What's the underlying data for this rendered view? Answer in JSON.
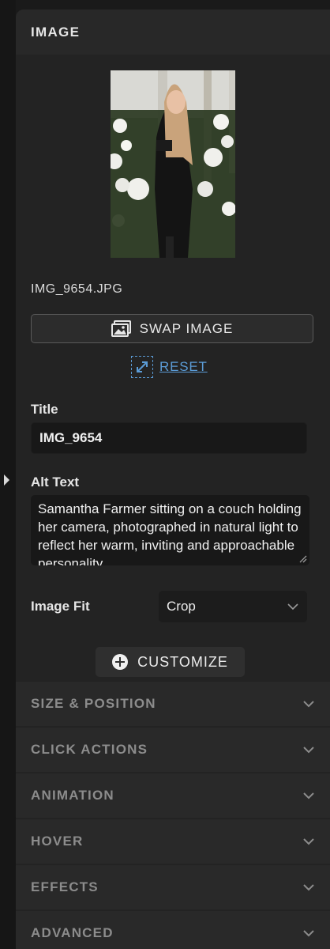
{
  "panel": {
    "title": "IMAGE"
  },
  "image": {
    "filename": "IMG_9654.JPG"
  },
  "actions": {
    "swap_label": "SWAP IMAGE",
    "reset_label": "RESET",
    "customize_label": "CUSTOMIZE"
  },
  "fields": {
    "title_label": "Title",
    "title_value": "IMG_9654",
    "alt_label": "Alt Text",
    "alt_value": "Samantha Farmer sitting on a couch holding her camera, photographed in natural light to reflect her warm, inviting and approachable personality",
    "fit_label": "Image Fit",
    "fit_value": "Crop"
  },
  "sections": [
    {
      "label": "SIZE & POSITION"
    },
    {
      "label": "CLICK ACTIONS"
    },
    {
      "label": "ANIMATION"
    },
    {
      "label": "HOVER"
    },
    {
      "label": "EFFECTS"
    },
    {
      "label": "ADVANCED"
    }
  ],
  "colors": {
    "accent": "#5b9bd5",
    "panel_bg": "#232323",
    "input_bg": "#181818"
  },
  "icons": [
    "image-stack-icon",
    "resize-arrows-icon",
    "plus-circle-icon",
    "chevron-down-icon",
    "triangle-right-icon"
  ]
}
